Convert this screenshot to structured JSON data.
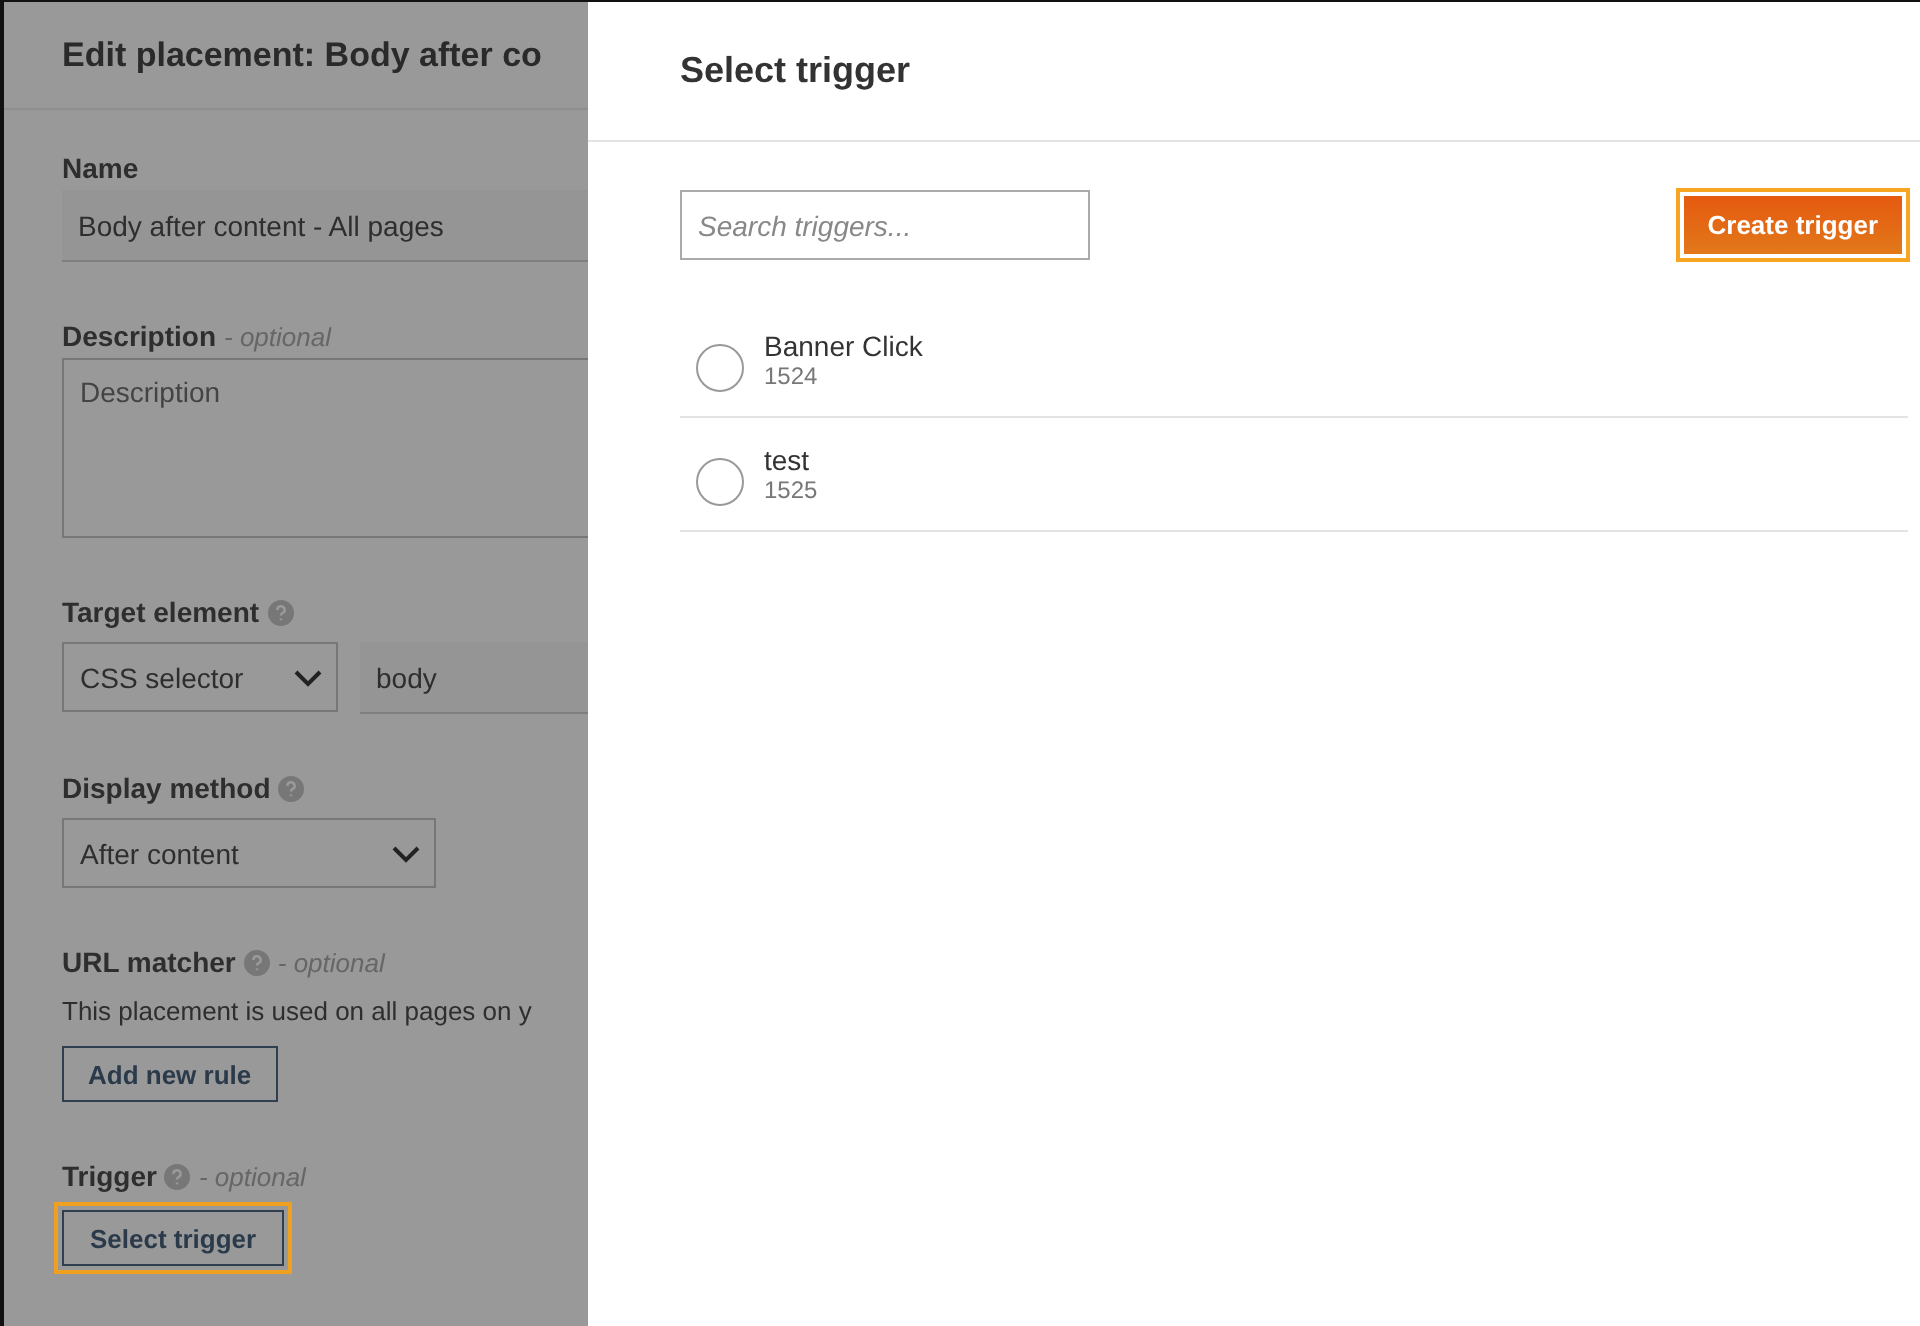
{
  "background_panel": {
    "title": "Edit placement: Body after co",
    "fields": [
      {
        "kind": "text",
        "label": "Name",
        "value": "Body after content - All pages"
      },
      {
        "kind": "textarea",
        "label": "Description",
        "optional": "- optional",
        "placeholder": "Description"
      },
      {
        "kind": "select-text",
        "label": "Target element",
        "help": true,
        "select": "CSS selector",
        "value": "body"
      },
      {
        "kind": "select",
        "label": "Display method",
        "help": true,
        "select": "After content"
      },
      {
        "kind": "button",
        "label": "URL matcher",
        "help": true,
        "optional": "- optional",
        "note": "This placement is used on all pages on y",
        "button": "Add new rule",
        "focused": false
      },
      {
        "kind": "button",
        "label": "Trigger",
        "help": true,
        "optional": "- optional",
        "button": "Select trigger",
        "focused": true
      }
    ]
  },
  "dialog": {
    "title": "Select trigger",
    "search": {
      "placeholder": "Search triggers..."
    },
    "create_button": "Create trigger",
    "triggers": [
      {
        "name": "Banner Click",
        "id": "1524",
        "selected": false
      },
      {
        "name": "test",
        "id": "1525",
        "selected": false
      }
    ]
  }
}
